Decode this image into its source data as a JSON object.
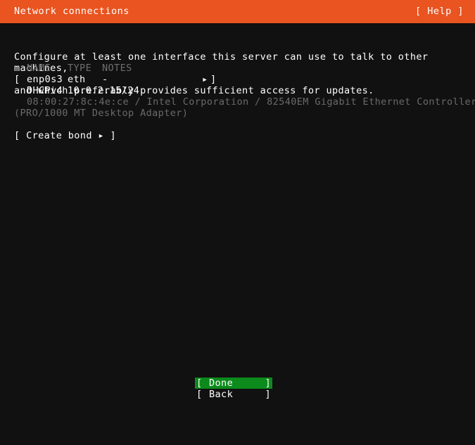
{
  "header": {
    "title": "Network connections",
    "help_label": "[ Help ]"
  },
  "intro": {
    "line1": "Configure at least one interface this server can use to talk to other machines,",
    "line2": "and which preferably provides sufficient access for updates."
  },
  "table": {
    "columns": {
      "name": "NAME",
      "type": "TYPE",
      "notes": "NOTES"
    },
    "rows": [
      {
        "bracket_left": "[",
        "name": "enp0s3",
        "type": "eth",
        "notes": "-",
        "arrow": "▸",
        "bracket_right": "]",
        "detail_label": "DHCPv4",
        "detail_value": "10.0.2.15/24",
        "hardware_line1": "08:00:27:8c:4e:ce / Intel Corporation / 82540EM Gigabit Ethernet Controller",
        "hardware_line2": "(PRO/1000 MT Desktop Adapter)"
      }
    ]
  },
  "create_bond": {
    "bracket_left": "[",
    "label": "Create bond",
    "arrow": "▸",
    "bracket_right": "]"
  },
  "footer": {
    "buttons": [
      {
        "bracket_left": "[",
        "label": "Done",
        "bracket_right": "]",
        "selected": true
      },
      {
        "bracket_left": "[",
        "label": "Back",
        "bracket_right": "]",
        "selected": false
      }
    ]
  },
  "colors": {
    "header_bg": "#e95420",
    "screen_bg": "#111111",
    "text": "#ffffff",
    "dim_text": "#6a6a6a",
    "column_header": "#6e6e6e",
    "selection_bg": "#0c8a1c"
  }
}
